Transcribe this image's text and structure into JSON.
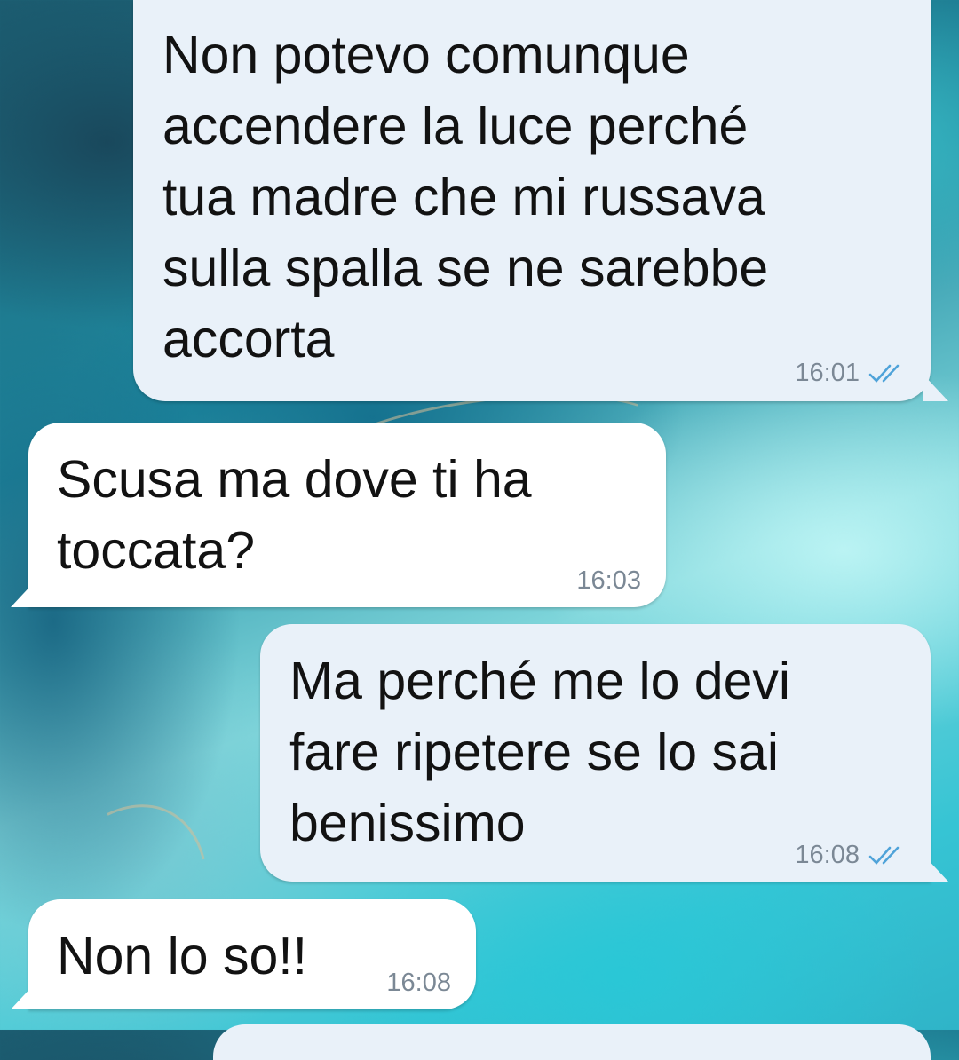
{
  "messages": [
    {
      "direction": "outgoing",
      "text": "Non potevo comunque\naccendere la luce perché\ntua madre che mi russava\nsulla spalla se ne sarebbe\naccorta",
      "time": "16:01",
      "status_icon": "double-check-read-icon"
    },
    {
      "direction": "incoming",
      "text": "Scusa ma dove ti ha\ntoccata?",
      "time": "16:03"
    },
    {
      "direction": "outgoing",
      "text": "Ma perché me lo devi\nfare ripetere se lo sai\nbenissimo",
      "time": "16:08",
      "status_icon": "double-check-read-icon"
    },
    {
      "direction": "incoming",
      "text": "Non lo so!!",
      "time": "16:08"
    }
  ],
  "colors": {
    "outgoing_bubble": "#e9f1f9",
    "incoming_bubble": "#ffffff",
    "read_tick": "#4fa3d9",
    "time_text": "#7b8895"
  }
}
